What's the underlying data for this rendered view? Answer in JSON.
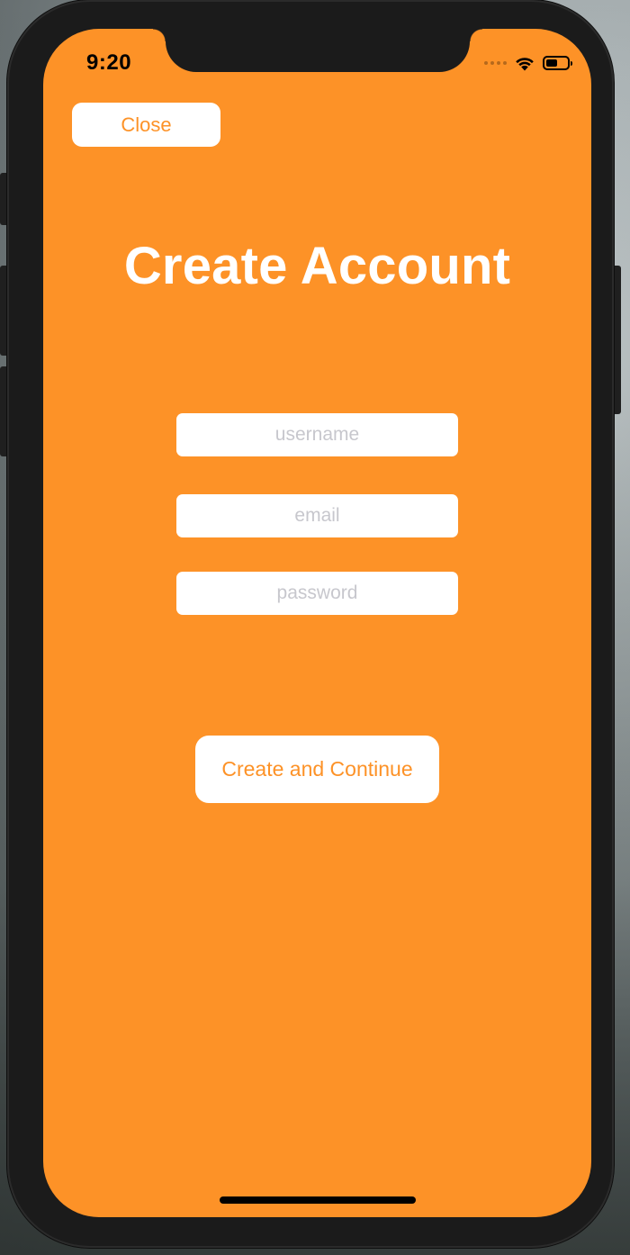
{
  "status_bar": {
    "time": "9:20",
    "signal_icon": "signal-dots-icon",
    "wifi_icon": "wifi-icon",
    "battery_icon": "battery-icon"
  },
  "nav": {
    "close_label": "Close"
  },
  "main": {
    "title": "Create Account",
    "fields": {
      "username": {
        "placeholder": "username",
        "value": ""
      },
      "email": {
        "placeholder": "email",
        "value": ""
      },
      "password": {
        "placeholder": "password",
        "value": ""
      }
    },
    "submit_label": "Create and Continue"
  },
  "colors": {
    "accent": "#FD9227",
    "background": "#FD9227",
    "surface": "#FFFFFF",
    "title_text": "#FFFFFF",
    "placeholder": "#C7C7CD"
  }
}
